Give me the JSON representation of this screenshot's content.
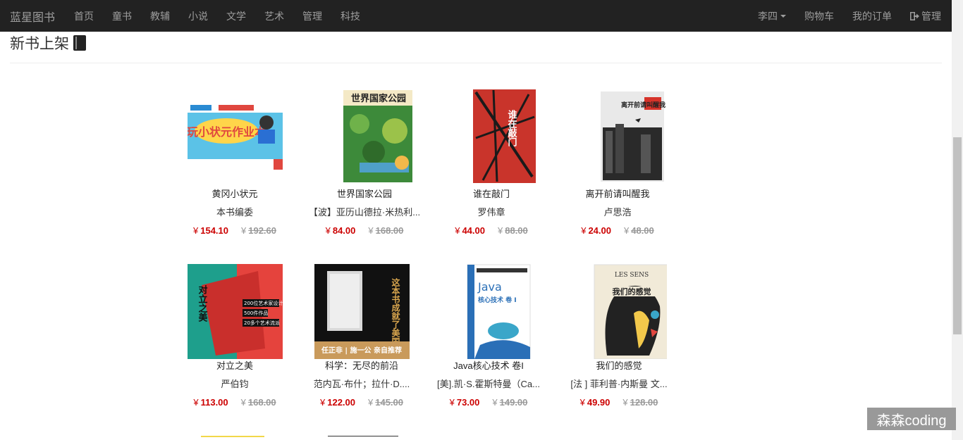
{
  "navbar": {
    "brand": "蓝星图书",
    "links": [
      "首页",
      "童书",
      "教辅",
      "小说",
      "文学",
      "艺术",
      "管理",
      "科技"
    ],
    "user": "李四",
    "cart": "购物车",
    "orders": "我的订单",
    "admin": "管理"
  },
  "page": {
    "title": "新书上架"
  },
  "books": [
    {
      "title": "黄冈小状元",
      "author": "本书编委",
      "price": "154.10",
      "original_price": "192.60"
    },
    {
      "title": "世界国家公园",
      "author": "【波】亚历山德拉·米热利...",
      "price": "84.00",
      "original_price": "168.00"
    },
    {
      "title": "谁在敲门",
      "author": "罗伟章",
      "price": "44.00",
      "original_price": "88.00"
    },
    {
      "title": "离开前请叫醒我",
      "author": "卢思浩",
      "price": "24.00",
      "original_price": "48.00"
    },
    {
      "title": "对立之美",
      "author": "严伯钧",
      "price": "113.00",
      "original_price": "168.00"
    },
    {
      "title": "科学：无尽的前沿",
      "author": "范内瓦·布什；拉什·D....",
      "price": "122.00",
      "original_price": "145.00"
    },
    {
      "title": "Java核心技术 卷I",
      "author": "[美].凯·S.霍斯特曼（Ca...",
      "price": "73.00",
      "original_price": "149.00"
    },
    {
      "title": "我们的感觉",
      "author": "[法 ] 菲利普·内斯曼 文...",
      "price": "49.90",
      "original_price": "128.00"
    }
  ],
  "currency": "¥",
  "covers": {
    "b1": {
      "main": "玩小状元作业本"
    },
    "b2": {
      "main": "世界国家公园"
    },
    "b3": {
      "main": "谁在敲门"
    },
    "b4": {
      "main": "离开前请叫醒我"
    },
    "b5": {
      "main": "对立之美",
      "tags": [
        "200位艺术家设计",
        "500件作品",
        "20多个艺术流派"
      ]
    },
    "b6": {
      "main": "这本书成就了美国你会从中受益",
      "banner": "任正非 | 施一公 亲自推荐"
    },
    "b7": {
      "main": "Java",
      "sub": "核心技术 卷 I"
    },
    "b8": {
      "main": "我们的感觉",
      "top": "LES SENS"
    }
  },
  "watermark": "森森coding"
}
